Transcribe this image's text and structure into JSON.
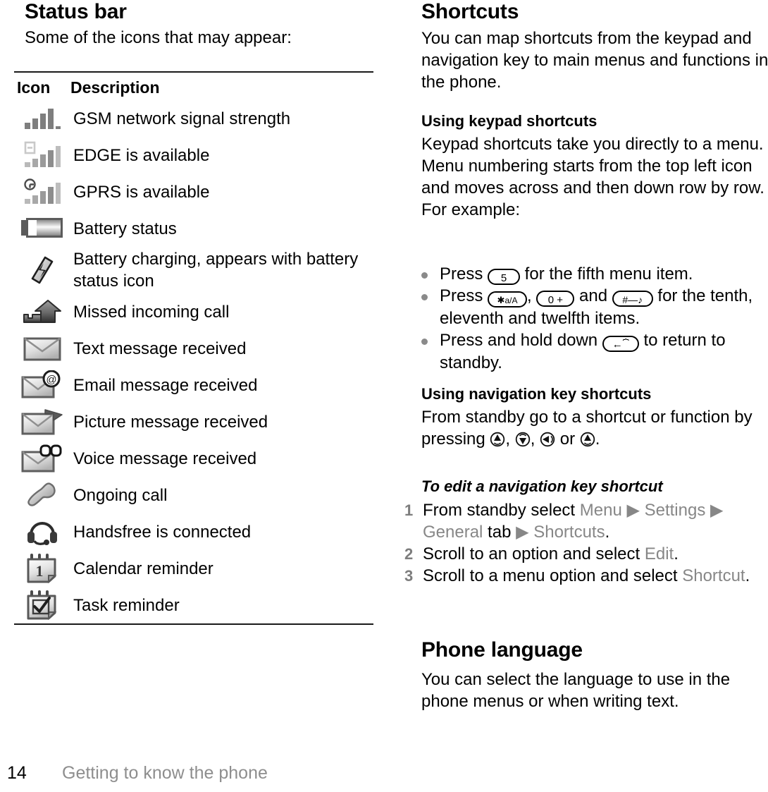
{
  "left": {
    "title": "Status bar",
    "lead": "Some of the icons that may appear:",
    "table": {
      "headers": {
        "icon": "Icon",
        "description": "Description"
      },
      "rows": [
        {
          "icon": "signal-strength-icon",
          "description": "GSM network signal strength"
        },
        {
          "icon": "edge-available-icon",
          "description": "EDGE is available"
        },
        {
          "icon": "gprs-available-icon",
          "description": "GPRS is available"
        },
        {
          "icon": "battery-status-icon",
          "description": "Battery status"
        },
        {
          "icon": "battery-charging-icon",
          "description": "Battery charging, appears with battery status icon"
        },
        {
          "icon": "missed-incoming-call-icon",
          "description": "Missed incoming call"
        },
        {
          "icon": "text-message-icon",
          "description": "Text message received"
        },
        {
          "icon": "email-message-icon",
          "description": "Email message received"
        },
        {
          "icon": "picture-message-icon",
          "description": "Picture message received"
        },
        {
          "icon": "voice-message-icon",
          "description": "Voice message received"
        },
        {
          "icon": "ongoing-call-icon",
          "description": "Ongoing call"
        },
        {
          "icon": "handsfree-icon",
          "description": "Handsfree is connected"
        },
        {
          "icon": "calendar-reminder-icon",
          "description": "Calendar reminder"
        },
        {
          "icon": "task-reminder-icon",
          "description": "Task reminder"
        }
      ]
    }
  },
  "right": {
    "title": "Shortcuts",
    "intro": "You can map shortcuts from the keypad and navigation key to main menus and functions in the phone.",
    "keypad": {
      "heading": "Using keypad shortcuts",
      "body": "Keypad shortcuts take you directly to a menu. Menu numbering starts from the top left icon and moves across and then down row by row. For example:",
      "bullets": [
        {
          "parts": [
            "Press ",
            " for the fifth menu item."
          ],
          "keys": [
            "5"
          ]
        },
        {
          "parts": [
            "Press ",
            ", ",
            " and ",
            " for the tenth, eleventh and twelfth items."
          ],
          "keys": [
            "*a/A",
            "0 +",
            "#-♪"
          ]
        },
        {
          "parts": [
            "Press and hold down ",
            " to return to standby."
          ],
          "keys": [
            "back"
          ]
        }
      ],
      "key_labels": {
        "five": "5",
        "star": "a/A",
        "zero": "0",
        "zero_plus": "+",
        "hash": "#"
      }
    },
    "navigation": {
      "heading": "Using navigation key shortcuts",
      "body_before": "From standby go to a shortcut or function by pressing ",
      "sep1": ", ",
      "sep2": ", ",
      "sep3": " or ",
      "body_end": ".",
      "keys": [
        "nav-up-icon",
        "nav-down-icon",
        "nav-left-icon",
        "nav-right-icon"
      ]
    },
    "procedure": {
      "heading": "To edit a navigation key shortcut",
      "steps": [
        {
          "num": "1",
          "segments": [
            {
              "text": "From standby select ",
              "style": "normal"
            },
            {
              "text": "Menu",
              "style": "ui"
            },
            {
              "text": " ▶ ",
              "style": "ui"
            },
            {
              "text": "Settings",
              "style": "ui"
            },
            {
              "text": " ▶ ",
              "style": "ui"
            },
            {
              "text": "General",
              "style": "ui"
            },
            {
              "text": " tab ",
              "style": "normal"
            },
            {
              "text": "▶ ",
              "style": "ui"
            },
            {
              "text": "Shortcuts",
              "style": "ui"
            },
            {
              "text": ".",
              "style": "normal"
            }
          ]
        },
        {
          "num": "2",
          "segments": [
            {
              "text": "Scroll to an option and select ",
              "style": "normal"
            },
            {
              "text": "Edit",
              "style": "ui"
            },
            {
              "text": ".",
              "style": "normal"
            }
          ]
        },
        {
          "num": "3",
          "segments": [
            {
              "text": "Scroll to a menu option and select ",
              "style": "normal"
            },
            {
              "text": "Shortcut",
              "style": "ui"
            },
            {
              "text": ".",
              "style": "normal"
            }
          ]
        }
      ]
    },
    "language": {
      "title": "Phone language",
      "body": "You can select the language to use in the phone menus or when writing text."
    }
  },
  "footer": {
    "page_number": "14",
    "section": "Getting to know the phone"
  },
  "colors": {
    "text": "#000000",
    "ui_term": "#878787",
    "step_number": "#7d7d7d",
    "bullet": "#8a8a8a",
    "rule": "#1a1a1a",
    "footer_title": "#8e8e8e"
  }
}
